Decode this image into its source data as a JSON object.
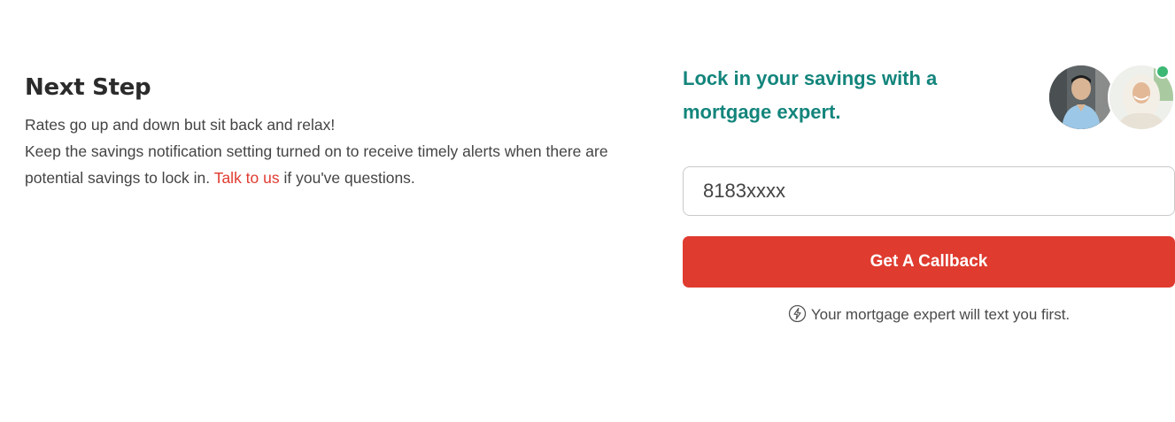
{
  "next_step": {
    "heading": "Next Step",
    "line1": "Rates go up and down but sit back and relax!",
    "line2": "Keep the savings notification setting turned on to receive timely alerts when there are potential savings to lock in. ",
    "link_text": "Talk to us",
    "line2_suffix": " if you've questions."
  },
  "callback_panel": {
    "tagline": "Lock in your savings with a mortgage expert.",
    "phone_value": "8183xxxx",
    "button_label": "Get A Callback",
    "note": "Your mortgage expert will text you first.",
    "note_icon": "lightning-icon",
    "online_status_color": "#3cb874"
  },
  "colors": {
    "accent_red": "#df3b2f",
    "teal": "#13857c",
    "heading": "#2b2b2b",
    "body_text": "#444444"
  }
}
